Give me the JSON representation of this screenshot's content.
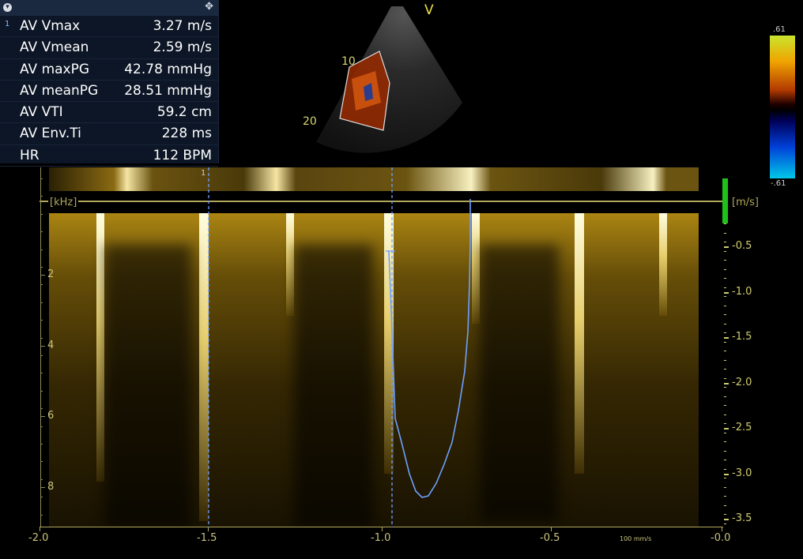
{
  "measurements": {
    "index": "1",
    "rows": [
      {
        "label": "AV Vmax",
        "value": "3.27 m/s"
      },
      {
        "label": "AV Vmean",
        "value": "2.59 m/s"
      },
      {
        "label": "AV maxPG",
        "value": "42.78 mmHg"
      },
      {
        "label": "AV meanPG",
        "value": "28.51 mmHg"
      },
      {
        "label": "AV VTI",
        "value": "59.2 cm"
      },
      {
        "label": "AV Env.Ti",
        "value": "228 ms"
      },
      {
        "label": "HR",
        "value": "112 BPM"
      }
    ]
  },
  "sector": {
    "mode_label": "V",
    "depth_labels": [
      "10",
      "20"
    ]
  },
  "colorbar": {
    "top": ".61",
    "bottom": "-.61"
  },
  "doppler": {
    "left_unit": "[kHz]",
    "right_unit": "[m/s]",
    "left_ticks": [
      "2",
      "4",
      "6",
      "8"
    ],
    "velocity_ticks": [
      "-0.5",
      "-1.0",
      "-1.5",
      "-2.0",
      "-2.5",
      "-3.0",
      "-3.5"
    ],
    "time_ticks": [
      "-2.0",
      "-1.5",
      "-1.0",
      "-0.5",
      "-0.0"
    ],
    "sweep_speed": "100 mm/s",
    "caliper_label": "1"
  },
  "colors": {
    "spectrum": "#d8b82a",
    "trace": "#6fa0ff",
    "baseline": "#b2a85a",
    "scale_green": "#1fc21a"
  }
}
